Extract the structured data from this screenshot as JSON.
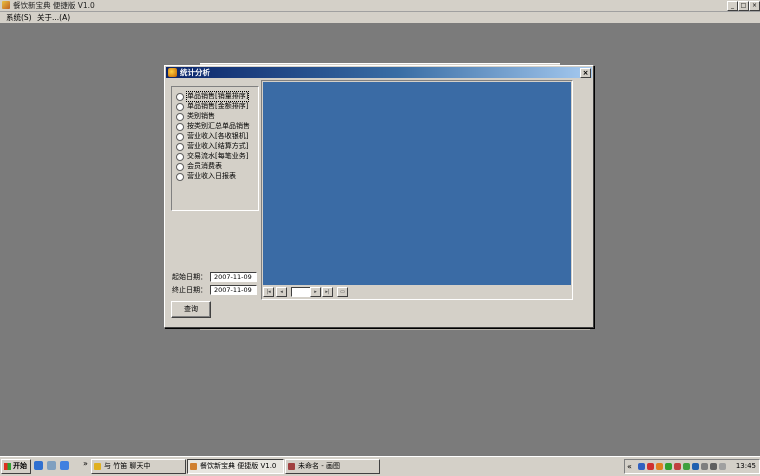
{
  "app": {
    "title": "餐饮新宝典 便捷版 V1.0",
    "min_glyph": "_",
    "max_glyph": "□",
    "close_glyph": "×"
  },
  "menu": {
    "items": [
      "系统(S)",
      "关于...(A)"
    ]
  },
  "dialog": {
    "title": "统计分析",
    "close_glyph": "×",
    "report_options": [
      "单品销售[销量排序]",
      "单品销售[金额排序]",
      "类别销售",
      "按类别汇总单品销售",
      "营业收入[各收银机]",
      "营业收入[结算方式]",
      "交易流水[每笔业务]",
      "会员消费表",
      "营业收入日报表"
    ],
    "selected_index": 0,
    "start_date_label": "起始日期：",
    "start_date_value": "2007-11-09",
    "end_date_label": "终止日期：",
    "end_date_value": "2007-11-09",
    "query_button": "查询",
    "viewer_color": "#3a6ba5",
    "nav_glyphs": {
      "first": "|◂",
      "prev": "◂",
      "next": "▸",
      "last": "▸|",
      "print": "▭"
    }
  },
  "taskbar": {
    "start_label": "开始",
    "quick_launch_icons": [
      "ie-icon",
      "desktop-icon",
      "media-icon"
    ],
    "overflow_glyph": "»",
    "tasks": [
      {
        "label": "与 竹笛 聊天中",
        "icon": "chat-icon",
        "active": false
      },
      {
        "label": "餐饮新宝典 便捷版 V1.0",
        "icon": "app-icon",
        "active": true
      },
      {
        "label": "未命名 - 画图",
        "icon": "paint-icon",
        "active": false
      }
    ],
    "tray_collapse_glyph": "«",
    "clock": "13:45"
  },
  "colors": {
    "desktop": "#7b7b7b",
    "face": "#d4d0c8",
    "title_active_start": "#0a246a",
    "title_active_end": "#a6caf0"
  }
}
